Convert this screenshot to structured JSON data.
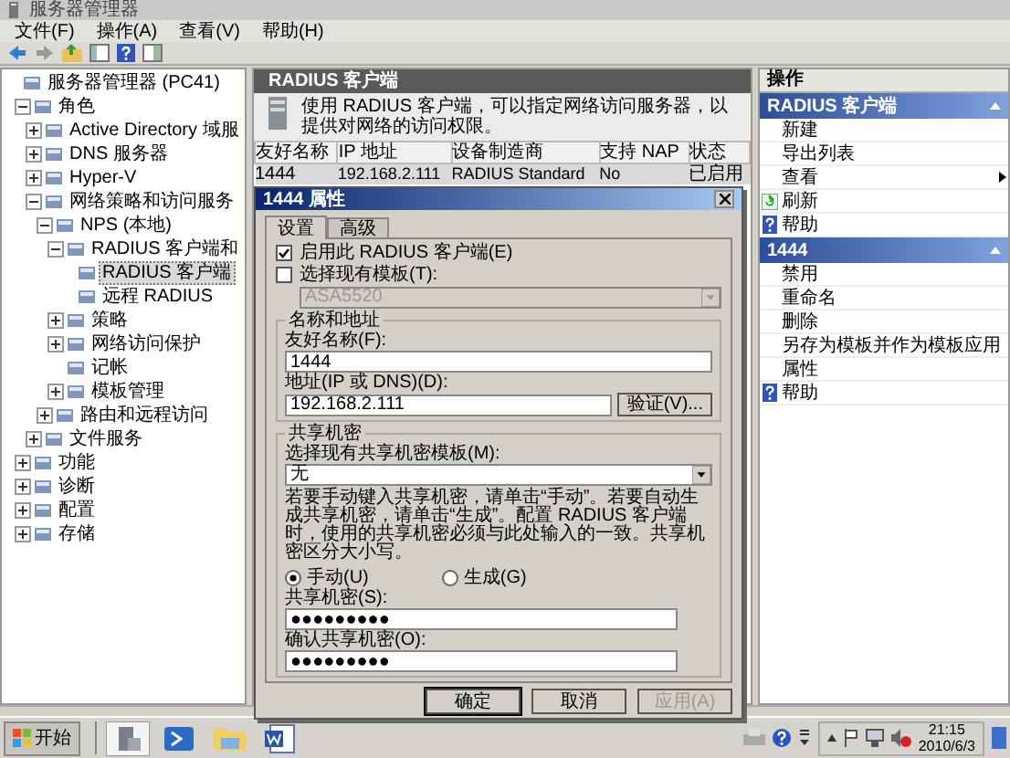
{
  "window": {
    "title": "服务器管理器"
  },
  "menu": [
    "文件(F)",
    "操作(A)",
    "查看(V)",
    "帮助(H)"
  ],
  "tree": [
    {
      "label": "服务器管理器 (PC41)",
      "selected": false,
      "children": [
        {
          "label": "角色",
          "expanded": true,
          "selected": false,
          "children": [
            {
              "label": "Active Directory 域服",
              "expanded": false,
              "selected": false
            },
            {
              "label": "DNS 服务器",
              "expanded": false,
              "selected": false
            },
            {
              "label": "Hyper-V",
              "expanded": false,
              "selected": false
            },
            {
              "label": "网络策略和访问服务",
              "expanded": true,
              "selected": false,
              "children": [
                {
                  "label": "NPS (本地)",
                  "expanded": true,
                  "selected": false,
                  "children": [
                    {
                      "label": "RADIUS 客户端和",
                      "expanded": true,
                      "selected": false,
                      "children": [
                        {
                          "label": "RADIUS 客户端",
                          "selected": true
                        },
                        {
                          "label": "远程 RADIUS",
                          "selected": false
                        }
                      ]
                    },
                    {
                      "label": "策略",
                      "expanded": false,
                      "selected": false
                    },
                    {
                      "label": "网络访问保护",
                      "expanded": false,
                      "selected": false
                    },
                    {
                      "label": "记帐",
                      "selected": false
                    },
                    {
                      "label": "模板管理",
                      "expanded": false,
                      "selected": false
                    }
                  ]
                },
                {
                  "label": "路由和远程访问",
                  "expanded": false,
                  "selected": false
                }
              ]
            },
            {
              "label": "文件服务",
              "expanded": false,
              "selected": false
            }
          ]
        },
        {
          "label": "功能",
          "expanded": false,
          "selected": false
        },
        {
          "label": "诊断",
          "expanded": false,
          "selected": false
        },
        {
          "label": "配置",
          "expanded": false,
          "selected": false
        },
        {
          "label": "存储",
          "expanded": false,
          "selected": false
        }
      ]
    }
  ],
  "center": {
    "header": "RADIUS 客户端",
    "description": "使用 RADIUS 客户端，可以指定网络访问服务器，以提供对网络的访问权限。",
    "columns": [
      "友好名称",
      "IP 地址",
      "设备制造商",
      "支持 NAP",
      "状态"
    ],
    "rows": [
      {
        "cells": [
          "1444",
          "192.168.2.111",
          "RADIUS Standard",
          "No",
          "已启用"
        ],
        "selected": true
      }
    ]
  },
  "dialog": {
    "title": "1444 属性",
    "tabs": [
      {
        "label": "设置",
        "selected": true
      },
      {
        "label": "高级",
        "selected": false
      }
    ],
    "enable_client": {
      "label": "启用此 RADIUS 客户端(E)",
      "checked": true
    },
    "use_template": {
      "label": "选择现有模板(T):",
      "checked": false
    },
    "template_select": {
      "value": "ASA5520",
      "disabled": true
    },
    "name_group": {
      "title": "名称和地址",
      "name_label": "友好名称(F):",
      "name_value": "1444",
      "address_label": "地址(IP 或 DNS)(D):",
      "address_value": "192.168.2.111",
      "verify_button": "验证(V)..."
    },
    "secret_group": {
      "title": "共享机密",
      "template_label": "选择现有共享机密模板(M):",
      "template_value": "无",
      "help": "若要手动键入共享机密，请单击“手动”。若要自动生成共享机密，请单击“生成”。配置 RADIUS 客户端时，使用的共享机密必须与此处输入的一致。共享机密区分大小写。",
      "modes": [
        {
          "label": "手动(U)",
          "selected": true
        },
        {
          "label": "生成(G)",
          "selected": false
        }
      ],
      "secret_label": "共享机密(S):",
      "secret_value": "●●●●●●●●●",
      "confirm_label": "确认共享机密(O):",
      "confirm_value": "●●●●●●●●●"
    },
    "buttons": [
      {
        "label": "确定",
        "disabled": false
      },
      {
        "label": "取消",
        "disabled": false
      },
      {
        "label": "应用(A)",
        "disabled": true
      }
    ]
  },
  "actions": {
    "title": "操作",
    "sections": [
      {
        "title": "RADIUS 客户端",
        "items": [
          {
            "label": "新建",
            "kind": "plain"
          },
          {
            "label": "导出列表",
            "kind": "plain"
          },
          {
            "label": "查看",
            "kind": "submenu"
          },
          {
            "label": "刷新",
            "kind": "refresh"
          },
          {
            "label": "帮助",
            "kind": "help"
          }
        ]
      },
      {
        "title": "1444",
        "items": [
          {
            "label": "禁用",
            "kind": "plain"
          },
          {
            "label": "重命名",
            "kind": "plain"
          },
          {
            "label": "删除",
            "kind": "plain"
          },
          {
            "label": "另存为模板并作为模板应用",
            "kind": "plain"
          },
          {
            "label": "属性",
            "kind": "plain"
          },
          {
            "label": "帮助",
            "kind": "help"
          }
        ]
      }
    ]
  },
  "taskbar": {
    "start": "开始",
    "time": "21:15",
    "date": "2010/6/3"
  }
}
